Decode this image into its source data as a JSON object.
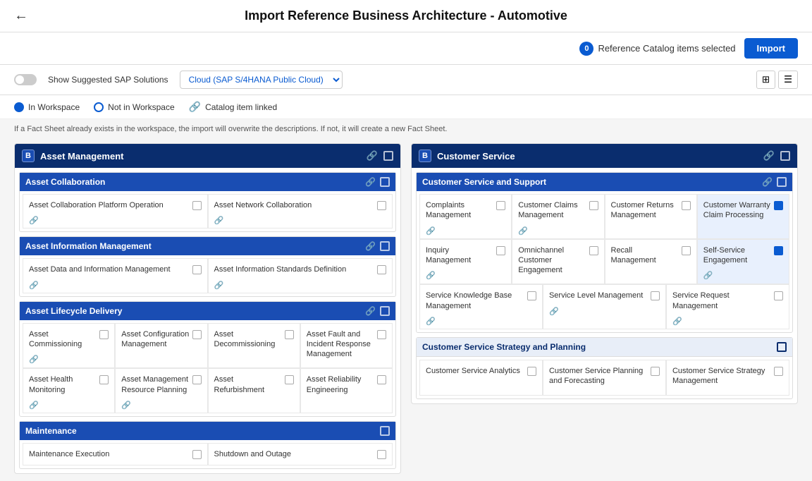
{
  "header": {
    "title": "Import Reference Business Architecture - Automotive",
    "back_label": "←"
  },
  "toolbar": {
    "selected_count": 0,
    "selected_label": "Reference Catalog items selected",
    "import_label": "Import"
  },
  "controls": {
    "toggle_label": "Show Suggested SAP Solutions",
    "cloud_label": "Cloud (SAP S/4HANA Public Cloud)",
    "view_grid_icon": "⊞",
    "view_list_icon": "☰"
  },
  "legend": {
    "in_workspace": "In Workspace",
    "not_in_workspace": "Not in Workspace",
    "catalog_linked": "Catalog item linked"
  },
  "info_bar": {
    "text": "If a Fact Sheet already exists in the workspace, the import will overwrite the descriptions. If not, it will create a new Fact Sheet."
  },
  "left_panel": {
    "title": "Asset Management",
    "badge": "B",
    "subsections": [
      {
        "title": "Asset Collaboration",
        "items": [
          {
            "name": "Asset Collaboration Platform Operation",
            "checked": false,
            "linked": true
          },
          {
            "name": "Asset Network Collaboration",
            "checked": false,
            "linked": true
          }
        ]
      },
      {
        "title": "Asset Information Management",
        "items": [
          {
            "name": "Asset Data and Information Management",
            "checked": false,
            "linked": true
          },
          {
            "name": "Asset Information Standards Definition",
            "checked": false,
            "linked": true
          }
        ]
      },
      {
        "title": "Asset Lifecycle Delivery",
        "items": [
          {
            "name": "Asset Commissioning",
            "checked": false,
            "linked": true
          },
          {
            "name": "Asset Configuration Management",
            "checked": false,
            "linked": false
          },
          {
            "name": "Asset Decommissioning",
            "checked": false,
            "linked": false
          },
          {
            "name": "Asset Fault and Incident Response Management",
            "checked": false,
            "linked": false
          },
          {
            "name": "Asset Health Monitoring",
            "checked": false,
            "linked": true
          },
          {
            "name": "Asset Management Resource Planning",
            "checked": false,
            "linked": true
          },
          {
            "name": "Asset Refurbishment",
            "checked": false,
            "linked": false
          },
          {
            "name": "Asset Reliability Engineering",
            "checked": false,
            "linked": false
          }
        ]
      },
      {
        "title": "Maintenance",
        "items": [
          {
            "name": "Maintenance Execution",
            "checked": false,
            "linked": false
          },
          {
            "name": "Shutdown and Outage",
            "checked": false,
            "linked": false
          }
        ]
      }
    ]
  },
  "right_panel": {
    "title": "Customer Service",
    "badge": "B",
    "subsections": [
      {
        "title": "Customer Service and Support",
        "items": [
          {
            "name": "Complaints Management",
            "checked": false,
            "linked": true
          },
          {
            "name": "Customer Claims Management",
            "checked": false,
            "linked": true
          },
          {
            "name": "Customer Returns Management",
            "checked": false,
            "linked": false
          },
          {
            "name": "Customer Warranty Claim Processing",
            "checked": true,
            "linked": false
          },
          {
            "name": "Inquiry Management",
            "checked": false,
            "linked": true
          },
          {
            "name": "Omnichannel Customer Engagement",
            "checked": false,
            "linked": false
          },
          {
            "name": "Recall Management",
            "checked": false,
            "linked": false
          },
          {
            "name": "Self-Service Engagement",
            "checked": true,
            "linked": true
          },
          {
            "name": "Service Knowledge Base Management",
            "checked": false,
            "linked": true
          },
          {
            "name": "Service Level Management",
            "checked": false,
            "linked": true
          },
          {
            "name": "Service Request Management",
            "checked": false,
            "linked": true
          }
        ]
      },
      {
        "title": "Customer Service Strategy and Planning",
        "items": [
          {
            "name": "Customer Service Analytics",
            "checked": false,
            "linked": false
          },
          {
            "name": "Customer Service Planning and Forecasting",
            "checked": false,
            "linked": false
          },
          {
            "name": "Customer Service Strategy Management",
            "checked": false,
            "linked": false
          }
        ]
      }
    ]
  }
}
